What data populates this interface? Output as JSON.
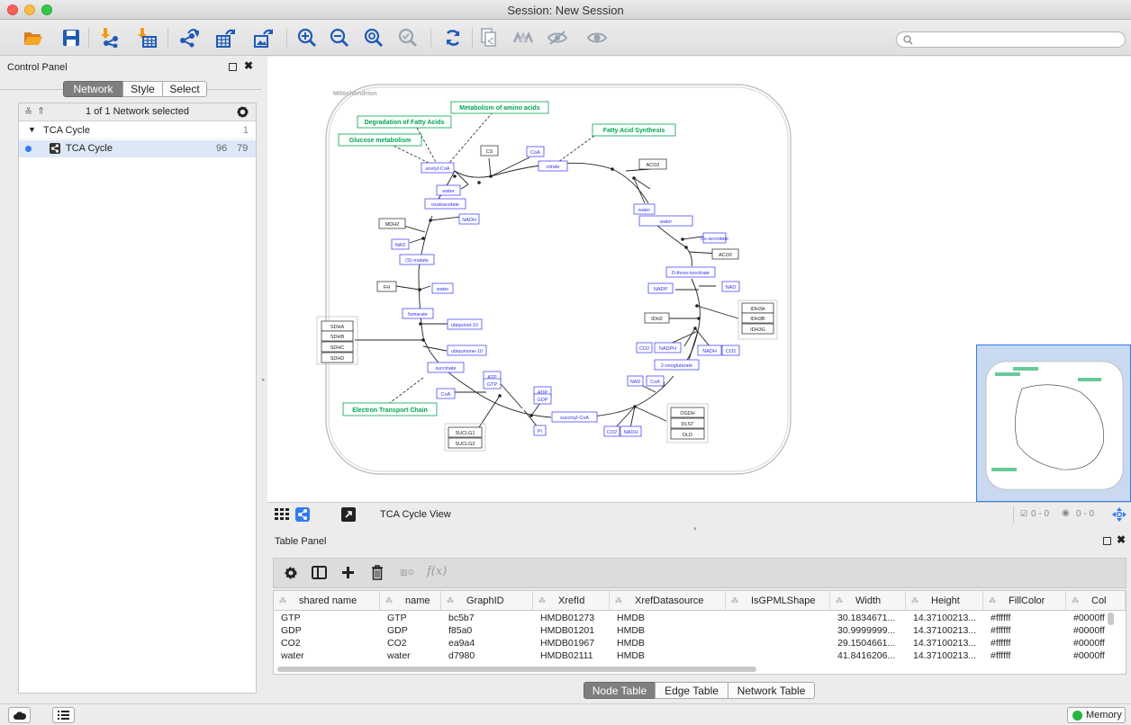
{
  "window": {
    "title": "Session: New Session"
  },
  "toolbar": {
    "icons": [
      "open-session-icon",
      "save-session-icon",
      "import-network-icon",
      "import-table-icon",
      "export-network-icon",
      "export-table-icon",
      "export-image-icon",
      "zoom-in-icon",
      "zoom-out-icon",
      "zoom-fit-icon",
      "zoom-selected-icon",
      "refresh-icon",
      "new-network-icon",
      "show-all-icon",
      "hide-icon",
      "show-icon"
    ],
    "search_placeholder": ""
  },
  "control_panel": {
    "title": "Control Panel",
    "tabs": [
      "Network",
      "Style",
      "Select"
    ],
    "selected_summary": "1 of 1 Network selected",
    "collection": {
      "name": "TCA Cycle",
      "count": "1"
    },
    "network": {
      "name": "TCA Cycle",
      "nodes": "96",
      "edges": "79"
    }
  },
  "network_view": {
    "compartment_label": "Mitochondrion",
    "pathway_labels": [
      "Metabolism of amino acids",
      "Degradation of Fatty Acids",
      "Glucose metabolism",
      "Fatty Acid Synthesis",
      "Electron Transport Chain"
    ],
    "metabolites": [
      "acetyl-CoA",
      "CoA",
      "citrate",
      "water",
      "oxaloacetate",
      "NADH",
      "NAD",
      "(S)-malate",
      "water",
      "fumarate",
      "ubiquinol-10",
      "ubiquinone-10",
      "succinate",
      "ATP",
      "GTP",
      "CoA",
      "ADP",
      "GDP",
      "Pi",
      "succinyl-CoA",
      "CO2",
      "NADH",
      "NAD",
      "CoA",
      "2-oxoglutarate",
      "CO2",
      "NADPH",
      "NADH",
      "CO2",
      "NADP",
      "NAD",
      "D-threo-isocitrate",
      "water",
      "cis-aconitate",
      "water"
    ],
    "genes": [
      "CS",
      "ACO2",
      "ACO2",
      "MDH2",
      "FH",
      "SDHA",
      "SDHB",
      "SDHC",
      "SDHD",
      "SUCLG1",
      "SUCLG2",
      "OGDH",
      "DLST",
      "DLD",
      "IDH2",
      "IDH3A",
      "IDH3B",
      "IDH3G"
    ]
  },
  "view_bar": {
    "view_title": "TCA Cycle View",
    "selection_nodes": "0 - 0",
    "hidden_count": "0 - 0"
  },
  "table_panel": {
    "title": "Table Panel",
    "columns": [
      "shared name",
      "name",
      "GraphID",
      "XrefId",
      "XrefDatasource",
      "IsGPMLShape",
      "Width",
      "Height",
      "FillColor",
      "Col"
    ],
    "rows": [
      [
        "GTP",
        "GTP",
        "bc5b7",
        "HMDB01273",
        "HMDB",
        "",
        "30.1834671...",
        "14.37100213...",
        "#ffffff",
        "#0000ff"
      ],
      [
        "GDP",
        "GDP",
        "f85a0",
        "HMDB01201",
        "HMDB",
        "",
        "30.9999999...",
        "14.37100213...",
        "#ffffff",
        "#0000ff"
      ],
      [
        "CO2",
        "CO2",
        "ea9a4",
        "HMDB01967",
        "HMDB",
        "",
        "29.1504661...",
        "14.37100213...",
        "#ffffff",
        "#0000ff"
      ],
      [
        "water",
        "water",
        "d7980",
        "HMDB02111",
        "HMDB",
        "",
        "41.8416206...",
        "14.37100213...",
        "#ffffff",
        "#0000ff"
      ]
    ],
    "tabs": [
      "Node Table",
      "Edge Table",
      "Network Table"
    ]
  },
  "status_bar": {
    "memory_label": "Memory"
  },
  "colors": {
    "accent": "#2f7bf5",
    "metabolite": "#3333ff",
    "pathway": "#00a651",
    "memory_ok": "#27b43e"
  }
}
